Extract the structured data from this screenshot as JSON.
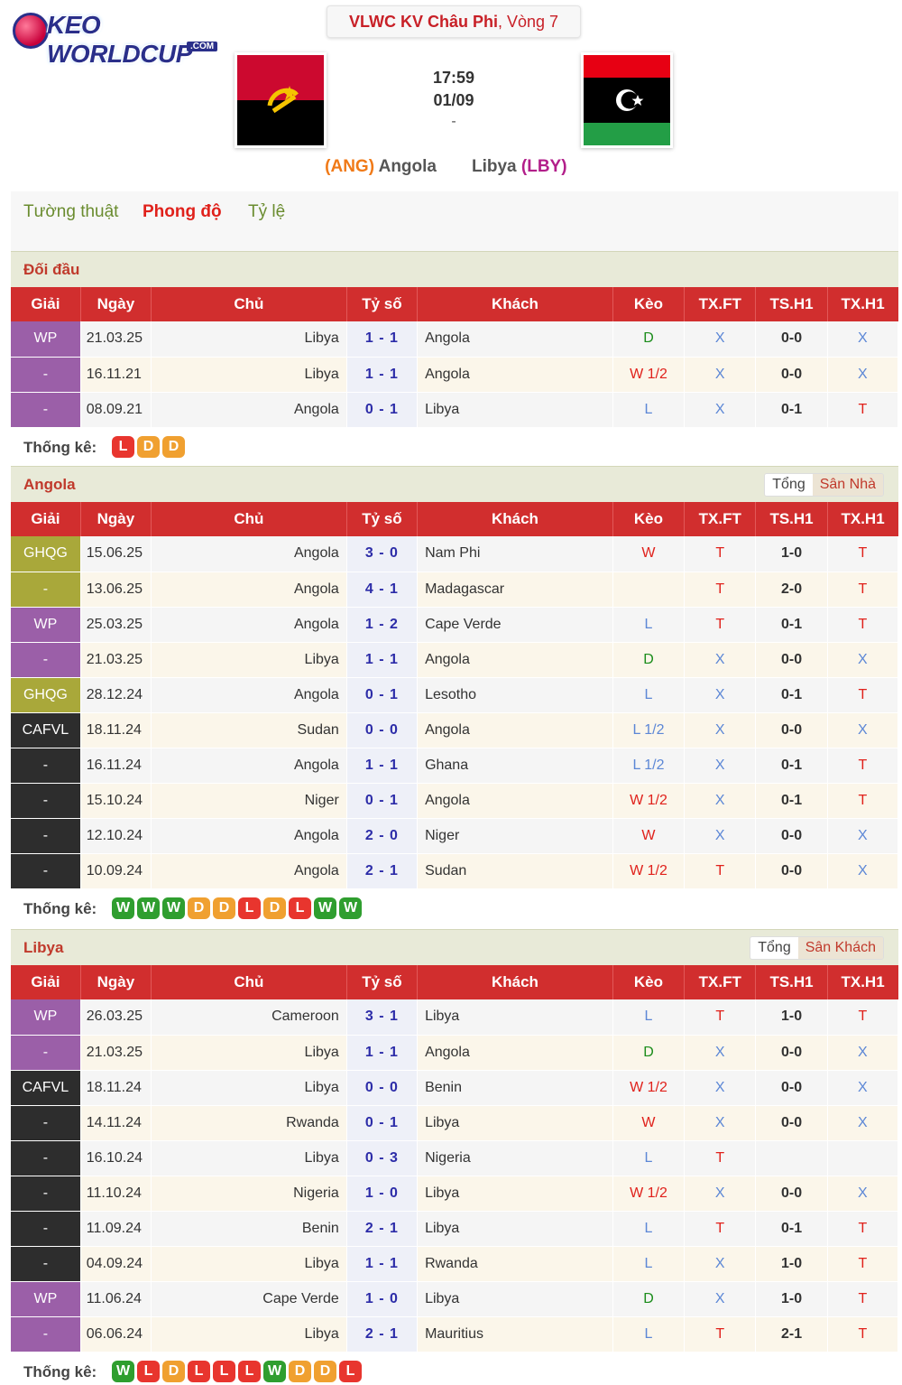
{
  "logo": {
    "text": "KEO WORLDCUP",
    "sub": ".COM"
  },
  "competition": {
    "name": "VLWC KV Châu Phi",
    "round": ", Vòng 7"
  },
  "match": {
    "time": "17:59",
    "date": "01/09",
    "score": "-"
  },
  "home_team": {
    "code": "(ANG)",
    "name": "Angola",
    "flag_icon": "angola-flag-icon"
  },
  "away_team": {
    "code": "(LBY)",
    "name": "Libya",
    "flag_icon": "libya-flag-icon"
  },
  "tabs": [
    {
      "label": "Tường thuật",
      "active": false
    },
    {
      "label": "Phong độ",
      "active": true
    },
    {
      "label": "Tỷ lệ",
      "active": false
    }
  ],
  "columns": [
    "Giải",
    "Ngày",
    "Chủ",
    "Tỷ số",
    "Khách",
    "Kèo",
    "TX.FT",
    "TS.H1",
    "TX.H1"
  ],
  "stat_label": "Thống kê:",
  "colors": {
    "header_red": "#d12e2e",
    "badge_W": "#2f9e2f",
    "badge_D": "#f0a030",
    "badge_L": "#e8352e",
    "comp_WP": "#9b5fa8",
    "comp_GHQG": "#a9a83a",
    "comp_CAFVL": "#2d2d2d"
  },
  "sections": [
    {
      "title": "Đối đầu",
      "toggle": null,
      "rows": [
        {
          "comp": "WP",
          "comp_color": "#9b5fa8",
          "date": "21.03.25",
          "home": "Libya",
          "score": "1 - 1",
          "away": "Angola",
          "keo": "D",
          "txft": "X",
          "tsh1": "0-0",
          "txh1": "X"
        },
        {
          "comp": "-",
          "comp_color": "#9b5fa8",
          "date": "16.11.21",
          "home": "Libya",
          "score": "1 - 1",
          "away": "Angola",
          "keo": "W 1/2",
          "txft": "X",
          "tsh1": "0-0",
          "txh1": "X"
        },
        {
          "comp": "-",
          "comp_color": "#9b5fa8",
          "date": "08.09.21",
          "home": "Angola",
          "score": "0 - 1",
          "away": "Libya",
          "keo": "L",
          "txft": "X",
          "tsh1": "0-1",
          "txh1": "T"
        }
      ],
      "stats": [
        "L",
        "D",
        "D"
      ]
    },
    {
      "title": "Angola",
      "toggle": {
        "all": "Tổng",
        "side": "Sân Nhà"
      },
      "rows": [
        {
          "comp": "GHQG",
          "comp_color": "#a9a83a",
          "date": "15.06.25",
          "home": "Angola",
          "score": "3 - 0",
          "away": "Nam Phi",
          "keo": "W",
          "txft": "T",
          "tsh1": "1-0",
          "txh1": "T"
        },
        {
          "comp": "-",
          "comp_color": "#a9a83a",
          "date": "13.06.25",
          "home": "Angola",
          "score": "4 - 1",
          "away": "Madagascar",
          "keo": "",
          "txft": "T",
          "tsh1": "2-0",
          "txh1": "T"
        },
        {
          "comp": "WP",
          "comp_color": "#9b5fa8",
          "date": "25.03.25",
          "home": "Angola",
          "score": "1 - 2",
          "away": "Cape Verde",
          "keo": "L",
          "txft": "T",
          "tsh1": "0-1",
          "txh1": "T"
        },
        {
          "comp": "-",
          "comp_color": "#9b5fa8",
          "date": "21.03.25",
          "home": "Libya",
          "score": "1 - 1",
          "away": "Angola",
          "keo": "D",
          "txft": "X",
          "tsh1": "0-0",
          "txh1": "X"
        },
        {
          "comp": "GHQG",
          "comp_color": "#a9a83a",
          "date": "28.12.24",
          "home": "Angola",
          "score": "0 - 1",
          "away": "Lesotho",
          "keo": "L",
          "txft": "X",
          "tsh1": "0-1",
          "txh1": "T"
        },
        {
          "comp": "CAFVL",
          "comp_color": "#2d2d2d",
          "date": "18.11.24",
          "home": "Sudan",
          "score": "0 - 0",
          "away": "Angola",
          "keo": "L 1/2",
          "txft": "X",
          "tsh1": "0-0",
          "txh1": "X"
        },
        {
          "comp": "-",
          "comp_color": "#2d2d2d",
          "date": "16.11.24",
          "home": "Angola",
          "score": "1 - 1",
          "away": "Ghana",
          "keo": "L 1/2",
          "txft": "X",
          "tsh1": "0-1",
          "txh1": "T"
        },
        {
          "comp": "-",
          "comp_color": "#2d2d2d",
          "date": "15.10.24",
          "home": "Niger",
          "score": "0 - 1",
          "away": "Angola",
          "keo": "W 1/2",
          "txft": "X",
          "tsh1": "0-1",
          "txh1": "T"
        },
        {
          "comp": "-",
          "comp_color": "#2d2d2d",
          "date": "12.10.24",
          "home": "Angola",
          "score": "2 - 0",
          "away": "Niger",
          "keo": "W",
          "txft": "X",
          "tsh1": "0-0",
          "txh1": "X"
        },
        {
          "comp": "-",
          "comp_color": "#2d2d2d",
          "date": "10.09.24",
          "home": "Angola",
          "score": "2 - 1",
          "away": "Sudan",
          "keo": "W 1/2",
          "txft": "T",
          "tsh1": "0-0",
          "txh1": "X"
        }
      ],
      "stats": [
        "W",
        "W",
        "W",
        "D",
        "D",
        "L",
        "D",
        "L",
        "W",
        "W"
      ]
    },
    {
      "title": "Libya",
      "toggle": {
        "all": "Tổng",
        "side": "Sân Khách"
      },
      "rows": [
        {
          "comp": "WP",
          "comp_color": "#9b5fa8",
          "date": "26.03.25",
          "home": "Cameroon",
          "score": "3 - 1",
          "away": "Libya",
          "keo": "L",
          "txft": "T",
          "tsh1": "1-0",
          "txh1": "T"
        },
        {
          "comp": "-",
          "comp_color": "#9b5fa8",
          "date": "21.03.25",
          "home": "Libya",
          "score": "1 - 1",
          "away": "Angola",
          "keo": "D",
          "txft": "X",
          "tsh1": "0-0",
          "txh1": "X"
        },
        {
          "comp": "CAFVL",
          "comp_color": "#2d2d2d",
          "date": "18.11.24",
          "home": "Libya",
          "score": "0 - 0",
          "away": "Benin",
          "keo": "W 1/2",
          "txft": "X",
          "tsh1": "0-0",
          "txh1": "X"
        },
        {
          "comp": "-",
          "comp_color": "#2d2d2d",
          "date": "14.11.24",
          "home": "Rwanda",
          "score": "0 - 1",
          "away": "Libya",
          "keo": "W",
          "txft": "X",
          "tsh1": "0-0",
          "txh1": "X"
        },
        {
          "comp": "-",
          "comp_color": "#2d2d2d",
          "date": "16.10.24",
          "home": "Libya",
          "score": "0 - 3",
          "away": "Nigeria",
          "keo": "L",
          "txft": "T",
          "tsh1": "",
          "txh1": ""
        },
        {
          "comp": "-",
          "comp_color": "#2d2d2d",
          "date": "11.10.24",
          "home": "Nigeria",
          "score": "1 - 0",
          "away": "Libya",
          "keo": "W 1/2",
          "txft": "X",
          "tsh1": "0-0",
          "txh1": "X"
        },
        {
          "comp": "-",
          "comp_color": "#2d2d2d",
          "date": "11.09.24",
          "home": "Benin",
          "score": "2 - 1",
          "away": "Libya",
          "keo": "L",
          "txft": "T",
          "tsh1": "0-1",
          "txh1": "T"
        },
        {
          "comp": "-",
          "comp_color": "#2d2d2d",
          "date": "04.09.24",
          "home": "Libya",
          "score": "1 - 1",
          "away": "Rwanda",
          "keo": "L",
          "txft": "X",
          "tsh1": "1-0",
          "txh1": "T"
        },
        {
          "comp": "WP",
          "comp_color": "#9b5fa8",
          "date": "11.06.24",
          "home": "Cape Verde",
          "score": "1 - 0",
          "away": "Libya",
          "keo": "D",
          "txft": "X",
          "tsh1": "1-0",
          "txh1": "T"
        },
        {
          "comp": "-",
          "comp_color": "#9b5fa8",
          "date": "06.06.24",
          "home": "Libya",
          "score": "2 - 1",
          "away": "Mauritius",
          "keo": "L",
          "txft": "T",
          "tsh1": "2-1",
          "txh1": "T"
        }
      ],
      "stats": [
        "W",
        "L",
        "D",
        "L",
        "L",
        "L",
        "W",
        "D",
        "D",
        "L"
      ]
    }
  ]
}
